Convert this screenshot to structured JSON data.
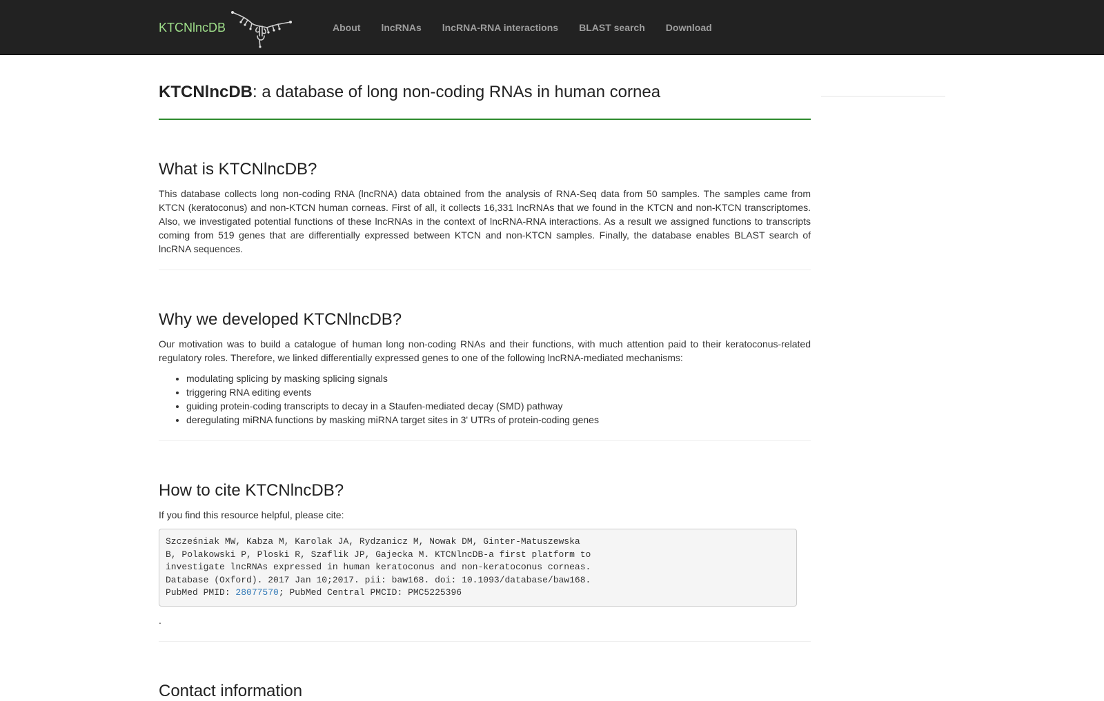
{
  "navbar": {
    "brand": "KTCNlncDB",
    "logo_icon": "lncrna-structure-icon",
    "items": [
      {
        "label": "About"
      },
      {
        "label": "lncRNAs"
      },
      {
        "label": "lncRNA-RNA interactions"
      },
      {
        "label": "BLAST search"
      },
      {
        "label": "Download"
      }
    ]
  },
  "header": {
    "title_bold": "KTCNlncDB",
    "title_rest": ": a database of long non-coding RNAs in human cornea"
  },
  "sections": {
    "what": {
      "heading": "What is KTCNlncDB?",
      "text": "This database collects long non-coding RNA (lncRNA) data obtained from the analysis of RNA-Seq data from 50 samples. The samples came from KTCN (keratoconus) and non-KTCN human corneas. First of all, it collects 16,331 lncRNAs that we found in the KTCN and non-KTCN transcriptomes. Also, we investigated potential functions of these lncRNAs in the context of lncRNA-RNA interactions. As a result we assigned functions to transcripts coming from 519 genes that are differentially expressed between KTCN and non-KTCN samples. Finally, the database enables BLAST search of lncRNA sequences."
    },
    "why": {
      "heading": "Why we developed KTCNlncDB?",
      "text": "Our motivation was to build a catalogue of human long non-coding RNAs and their functions, with much attention paid to their keratoconus-related regulatory roles. Therefore, we linked differentially expressed genes to one of the following lncRNA-mediated mechanisms:",
      "items": [
        "modulating splicing by masking splicing signals",
        "triggering RNA editing events",
        "guiding protein-coding transcripts to decay in a Staufen-mediated decay (SMD) pathway",
        "deregulating miRNA functions by masking miRNA target sites in 3' UTRs of protein-coding genes"
      ]
    },
    "cite": {
      "heading": "How to cite KTCNlncDB?",
      "intro": "If you find this resource helpful, please cite:",
      "citation": "Szcześniak MW, Kabza M, Karolak JA, Rydzanicz M, Nowak DM, Ginter-Matuszewska\nB, Polakowski P, Ploski R, Szaflik JP, Gajecka M. KTCNlncDB-a first platform to\ninvestigate lncRNAs expressed in human keratoconus and non-keratoconus corneas.\nDatabase (Oxford). 2017 Jan 10;2017. pii: baw168. doi: 10.1093/database/baw168.\nPubMed PMID: ",
      "pmid": "28077570",
      "citation_tail": "; PubMed Central PMCID: PMC5225396",
      "after": "."
    },
    "contact": {
      "heading": "Contact information"
    }
  }
}
